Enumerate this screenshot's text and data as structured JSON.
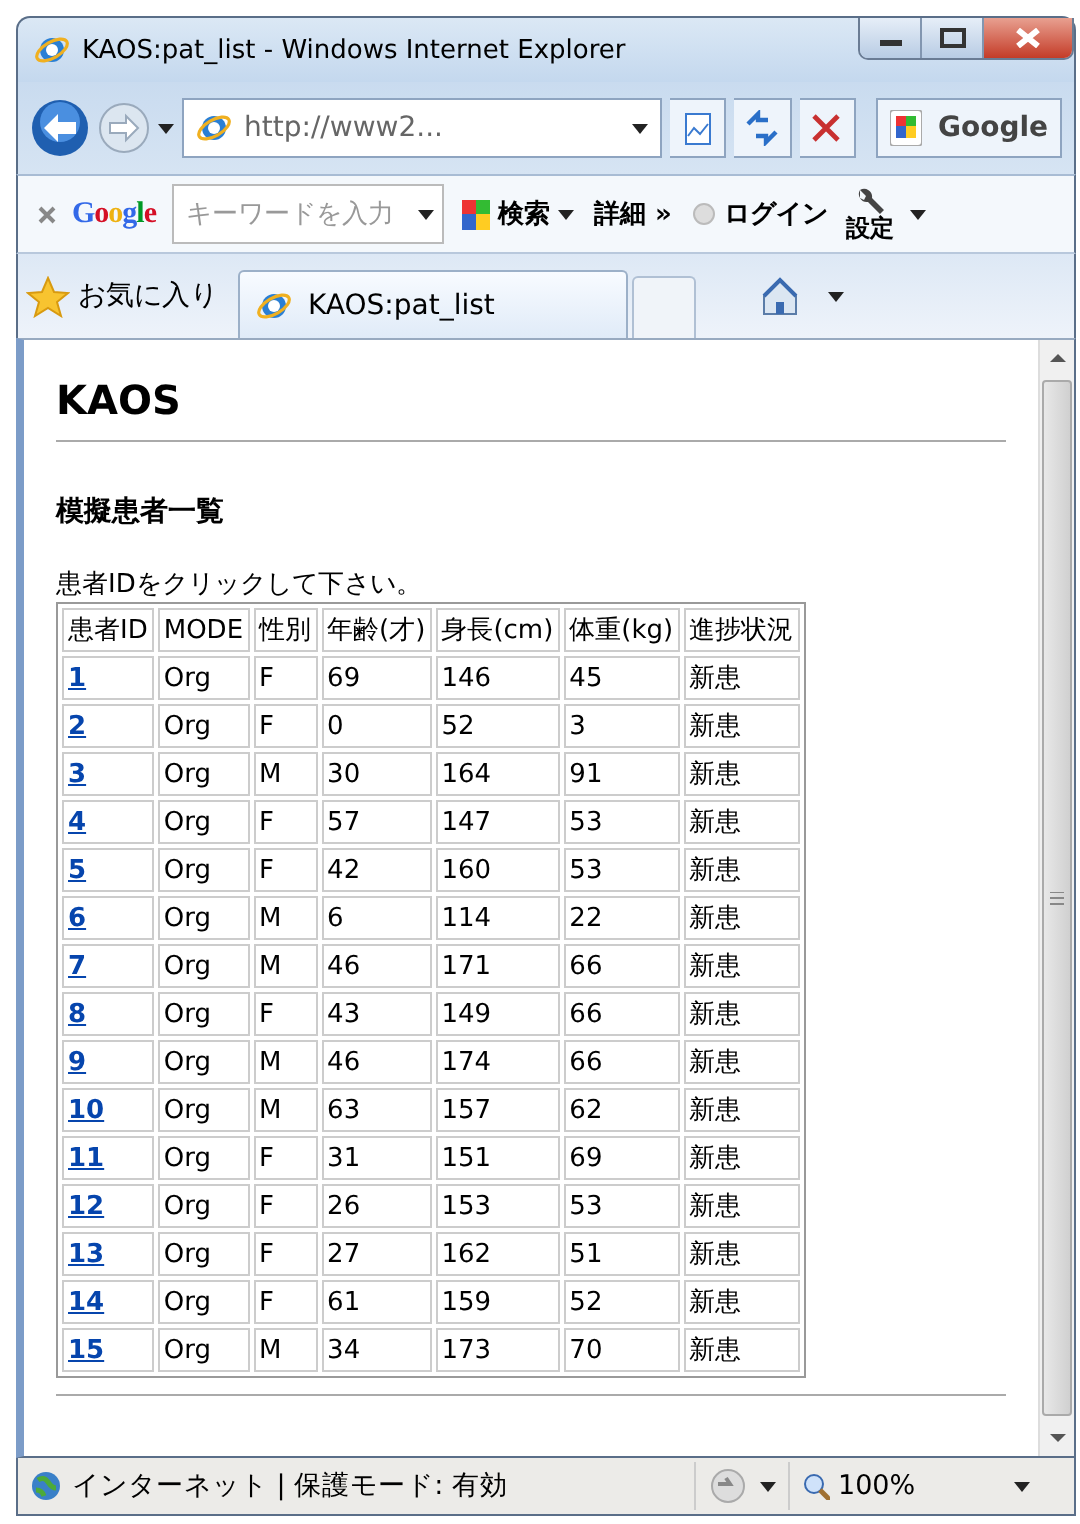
{
  "window": {
    "title": "KAOS:pat_list - Windows Internet Explorer"
  },
  "address_bar": {
    "value": "http://www2..."
  },
  "search_box": {
    "value": "Google"
  },
  "google_toolbar": {
    "logo": "Google",
    "search_placeholder": "キーワードを入力",
    "search_button": "検索",
    "more_button": "詳細 »",
    "login_button": "ログイン",
    "settings_button": "設定"
  },
  "favorites": {
    "label": "お気に入り"
  },
  "tabs": [
    {
      "label": "KAOS:pat_list",
      "selected": true
    }
  ],
  "page": {
    "heading": "KAOS",
    "subheading": "模擬患者一覧",
    "instruction": "患者IDをクリックして下さい。",
    "table": {
      "columns": [
        "患者ID",
        "MODE",
        "性別",
        "年齢(才)",
        "身長(cm)",
        "体重(kg)",
        "進捗状況"
      ],
      "rows": [
        [
          "1",
          "Org",
          "F",
          "69",
          "146",
          "45",
          "新患"
        ],
        [
          "2",
          "Org",
          "F",
          "0",
          "52",
          "3",
          "新患"
        ],
        [
          "3",
          "Org",
          "M",
          "30",
          "164",
          "91",
          "新患"
        ],
        [
          "4",
          "Org",
          "F",
          "57",
          "147",
          "53",
          "新患"
        ],
        [
          "5",
          "Org",
          "F",
          "42",
          "160",
          "53",
          "新患"
        ],
        [
          "6",
          "Org",
          "M",
          "6",
          "114",
          "22",
          "新患"
        ],
        [
          "7",
          "Org",
          "M",
          "46",
          "171",
          "66",
          "新患"
        ],
        [
          "8",
          "Org",
          "F",
          "43",
          "149",
          "66",
          "新患"
        ],
        [
          "9",
          "Org",
          "M",
          "46",
          "174",
          "66",
          "新患"
        ],
        [
          "10",
          "Org",
          "M",
          "63",
          "157",
          "62",
          "新患"
        ],
        [
          "11",
          "Org",
          "F",
          "31",
          "151",
          "69",
          "新患"
        ],
        [
          "12",
          "Org",
          "F",
          "26",
          "153",
          "53",
          "新患"
        ],
        [
          "13",
          "Org",
          "F",
          "27",
          "162",
          "51",
          "新患"
        ],
        [
          "14",
          "Org",
          "F",
          "61",
          "159",
          "52",
          "新患"
        ],
        [
          "15",
          "Org",
          "M",
          "34",
          "173",
          "70",
          "新患"
        ]
      ]
    }
  },
  "status_bar": {
    "zone": "インターネット | 保護モード: 有効",
    "zoom": "100%"
  }
}
